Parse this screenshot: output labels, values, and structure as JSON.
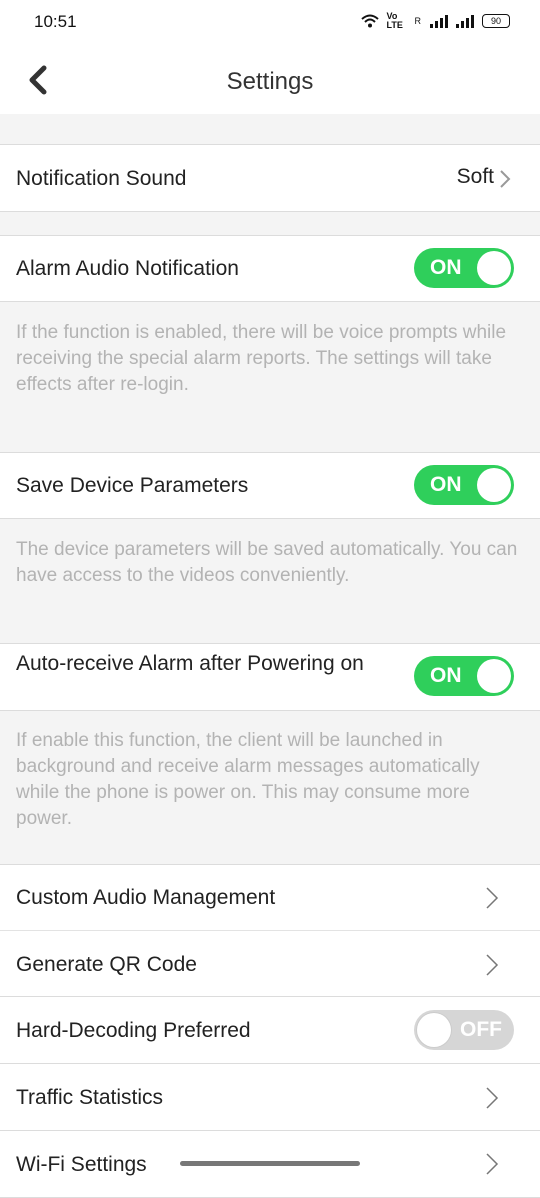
{
  "status_bar": {
    "time": "10:51",
    "volte_top": "Vo",
    "volte_bottom": "LTE",
    "signal_label": "R",
    "battery": "90"
  },
  "header": {
    "title": "Settings"
  },
  "settings": {
    "notification_sound": {
      "label": "Notification Sound",
      "value": "Soft"
    },
    "alarm_audio": {
      "label": "Alarm Audio Notification",
      "toggle": "ON",
      "description": "If the function is enabled, there will be voice prompts while receiving the special alarm reports. The settings will take effects after re-login."
    },
    "save_device_params": {
      "label": "Save Device Parameters",
      "toggle": "ON",
      "description": "The device parameters will be saved automatically. You can have access to the videos conveniently."
    },
    "auto_receive": {
      "label": "Auto-receive Alarm after Powering on",
      "toggle": "ON",
      "description": "If enable this function, the client will be launched in background and receive alarm messages automatically while the phone is power on. This may consume more power."
    },
    "custom_audio": {
      "label": "Custom Audio Management"
    },
    "qr_code": {
      "label": "Generate QR Code"
    },
    "hard_decoding": {
      "label": "Hard-Decoding Preferred",
      "toggle": "OFF"
    },
    "traffic": {
      "label": "Traffic Statistics"
    },
    "wifi": {
      "label": "Wi-Fi Settings"
    }
  },
  "colors": {
    "toggle_on": "#2fcf5b",
    "toggle_off": "#d6d6d6",
    "section_bg": "#f4f4f4",
    "desc_text": "#b3b3b3"
  }
}
